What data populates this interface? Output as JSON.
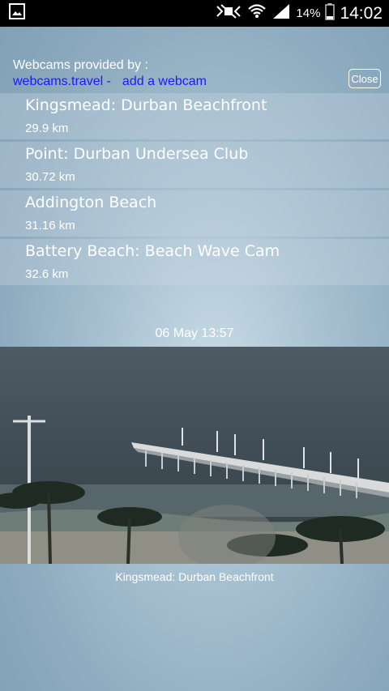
{
  "status_bar": {
    "battery_percent": "14%",
    "time": "14:02",
    "icons": [
      "image-notification-icon",
      "nfc-mute-icon",
      "wifi-icon",
      "signal-icon",
      "battery-icon"
    ]
  },
  "header": {
    "title": "Webcams provided by :",
    "link_provider": "webcams.travel -",
    "link_add": "add a webcam",
    "close_label": "Close"
  },
  "webcams": [
    {
      "name": "Kingsmead: Durban Beachfront",
      "distance": "29.9 km"
    },
    {
      "name": "Point: Durban Undersea Club",
      "distance": "30.72 km"
    },
    {
      "name": "Addington Beach",
      "distance": "31.16 km"
    },
    {
      "name": "Battery Beach: Beach Wave Cam",
      "distance": "32.6 km"
    }
  ],
  "selected_cam": {
    "timestamp": "06 May 13:57",
    "caption": "Kingsmead: Durban Beachfront"
  },
  "colors": {
    "link": "#1a1aff",
    "status_bar_bg": "#000000"
  }
}
